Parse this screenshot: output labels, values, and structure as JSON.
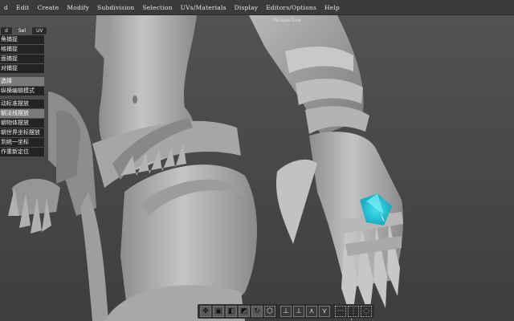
{
  "menubar": {
    "items": [
      "d",
      "Edit",
      "Create",
      "Modify",
      "Subdivision",
      "Selection",
      "UVs/Materials",
      "Display",
      "Editors/Options",
      "Help"
    ]
  },
  "viewport": {
    "label": "Perspective"
  },
  "mode_tabs": {
    "tabs": [
      "d",
      "Sel",
      "UV"
    ],
    "active": "Sel"
  },
  "side_panel": {
    "group1": [
      "角捕捉",
      "格捕捉",
      "面捕捉",
      "对捕捉"
    ],
    "group2": [
      "选择",
      "纵横编辑模式"
    ],
    "group3": [
      "动标准摆放",
      "朝法线摆放",
      "朝物体摆放",
      "朝世界坐标摆放",
      "到统一坐标",
      "作重新定位"
    ],
    "highlighted": [
      "选择",
      "朝法线摆放"
    ]
  },
  "bottom_toolbar": {
    "buttons": [
      "move-tool-icon",
      "cube-tool-icon",
      "half-cube-tool-icon",
      "cube-corner-tool-icon",
      "tumble-tool-icon",
      "hexagon-tool-icon",
      "axis-tool-icon",
      "axis-rotate-tool-icon",
      "axis-scale-tool-icon",
      "axis-universal-tool-icon",
      "soft-select-icon",
      "grid-select-icon",
      "lasso-select-icon"
    ]
  },
  "colors": {
    "background": "#4a4a4a",
    "model": "#a9a9a9",
    "highlight": "#19c6d8"
  }
}
